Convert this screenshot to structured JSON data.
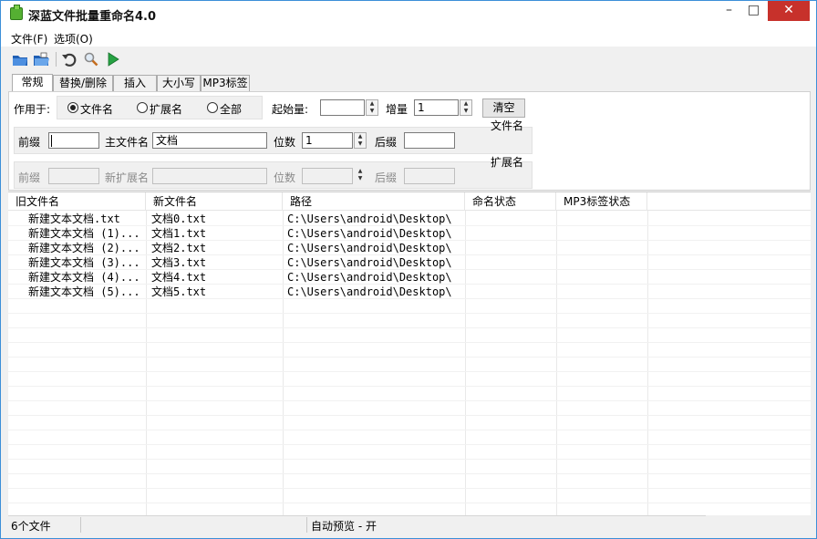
{
  "window": {
    "title": "深蓝文件批量重命名4.0"
  },
  "menu": {
    "file": "文件(F)",
    "options": "选项(O)"
  },
  "toolbar": [
    "open-folder-icon",
    "open-file-icon",
    "undo-icon",
    "search-icon",
    "run-icon"
  ],
  "tabs": [
    {
      "label": "常规",
      "active": true
    },
    {
      "label": "替换/删除",
      "active": false
    },
    {
      "label": "插入",
      "active": false
    },
    {
      "label": "大小写",
      "active": false
    },
    {
      "label": "MP3标签",
      "active": false
    }
  ],
  "apply": {
    "label": "作用于:",
    "filename": "文件名",
    "extension": "扩展名",
    "all": "全部",
    "selected": "filename"
  },
  "counter": {
    "start_label": "起始量:",
    "start_value": "",
    "inc_label": "增量",
    "inc_value": "1",
    "clear_label": "清空"
  },
  "filename_group": {
    "caption": "文件名",
    "prefix_label": "前缀",
    "prefix_value": "",
    "main_label": "主文件名",
    "main_value": "文档",
    "digits_label": "位数",
    "digits_value": "1",
    "suffix_label": "后缀",
    "suffix_value": ""
  },
  "ext_group": {
    "caption": "扩展名",
    "prefix_label": "前缀",
    "main_label": "新扩展名",
    "digits_label": "位数",
    "suffix_label": "后缀"
  },
  "columns": [
    "旧文件名",
    "新文件名",
    "路径",
    "命名状态",
    "MP3标签状态"
  ],
  "rows": [
    {
      "old": "新建文本文档.txt",
      "new": "文档0.txt",
      "path": "C:\\Users\\android\\Desktop\\"
    },
    {
      "old": "新建文本文档 (1)...",
      "new": "文档1.txt",
      "path": "C:\\Users\\android\\Desktop\\"
    },
    {
      "old": "新建文本文档 (2)...",
      "new": "文档2.txt",
      "path": "C:\\Users\\android\\Desktop\\"
    },
    {
      "old": "新建文本文档 (3)...",
      "new": "文档3.txt",
      "path": "C:\\Users\\android\\Desktop\\"
    },
    {
      "old": "新建文本文档 (4)...",
      "new": "文档4.txt",
      "path": "C:\\Users\\android\\Desktop\\"
    },
    {
      "old": "新建文本文档 (5)...",
      "new": "文档5.txt",
      "path": "C:\\Users\\android\\Desktop\\"
    }
  ],
  "status": {
    "count": "6个文件",
    "preview": "自动预览 - 开"
  }
}
